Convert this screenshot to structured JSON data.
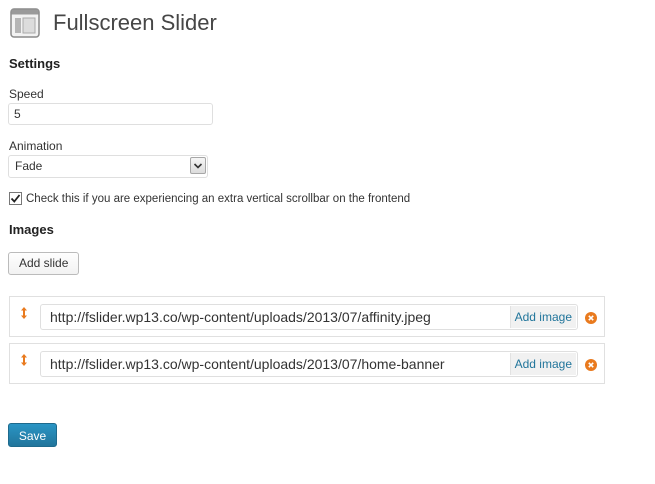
{
  "header": {
    "title": "Fullscreen Slider",
    "icon": "settings-page-icon"
  },
  "settings": {
    "heading": "Settings",
    "speed_label": "Speed",
    "speed_value": "5",
    "animation_label": "Animation",
    "animation_value": "Fade",
    "scrollbar_checked": true,
    "scrollbar_label": "Check this if you are experiencing an extra vertical scrollbar on the frontend"
  },
  "images": {
    "heading": "Images",
    "add_slide_label": "Add slide",
    "slides": [
      {
        "url": "http://fslider.wp13.co/wp-content/uploads/2013/07/affinity.jpeg",
        "add_image_label": "Add image"
      },
      {
        "url": "http://fslider.wp13.co/wp-content/uploads/2013/07/home-banner",
        "add_image_label": "Add image"
      }
    ]
  },
  "footer": {
    "save_label": "Save"
  },
  "colors": {
    "accent": "#21759b",
    "remove_icon": "#e97a1e",
    "drag_handle": "#e97a1e"
  }
}
